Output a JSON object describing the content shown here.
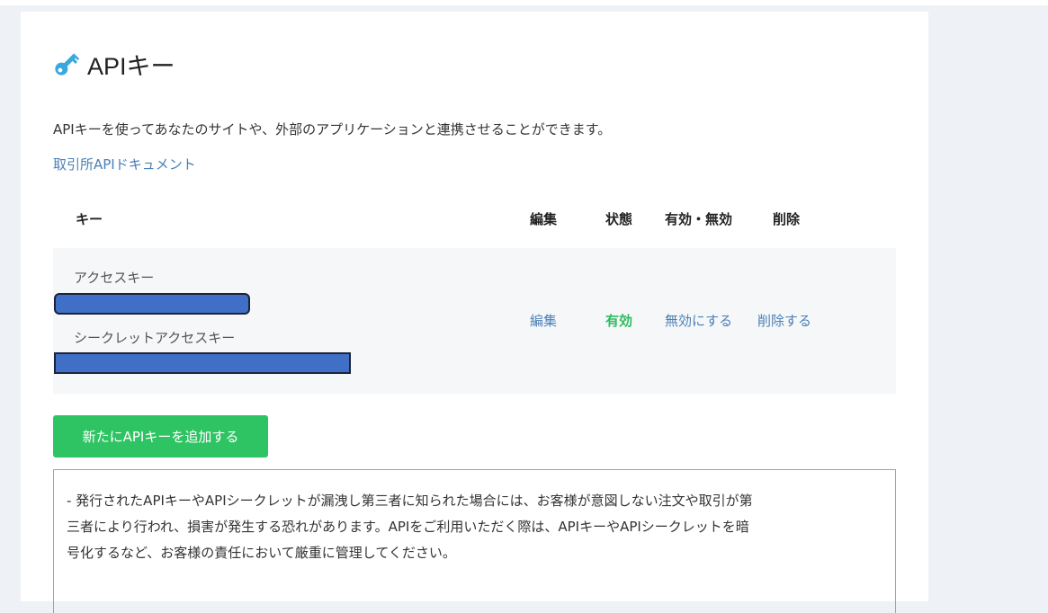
{
  "header": {
    "title": "APIキー",
    "icon": "key-icon"
  },
  "description": "APIキーを使ってあなたのサイトや、外部のアプリケーションと連携させることができます。",
  "doc_link": "取引所APIドキュメント",
  "table": {
    "headers": {
      "key": "キー",
      "edit": "編集",
      "status": "状態",
      "toggle": "有効・無効",
      "delete": "削除"
    },
    "row": {
      "access_label": "アクセスキー",
      "secret_label": "シークレットアクセスキー",
      "edit": "編集",
      "status": "有効",
      "toggle": "無効にする",
      "delete": "削除する"
    }
  },
  "add_button": "新たにAPIキーを追加する",
  "warning": {
    "lines": [
      "- 発行されたAPIキーやAPIシークレットが漏洩し第三者に知られた場合には、お客様が意図しない注文や取引が第",
      "三者により行われ、損害が発生する恐れがあります。APIをご利用いただく際は、APIキーやAPIシークレットを暗",
      "号化するなど、お客様の責任において厳重に管理してください。"
    ]
  },
  "colors": {
    "accent": "#4a7fb5",
    "success": "#2fc463",
    "redaction": "#3f6fc6",
    "warning_border": "#e08a7a"
  }
}
